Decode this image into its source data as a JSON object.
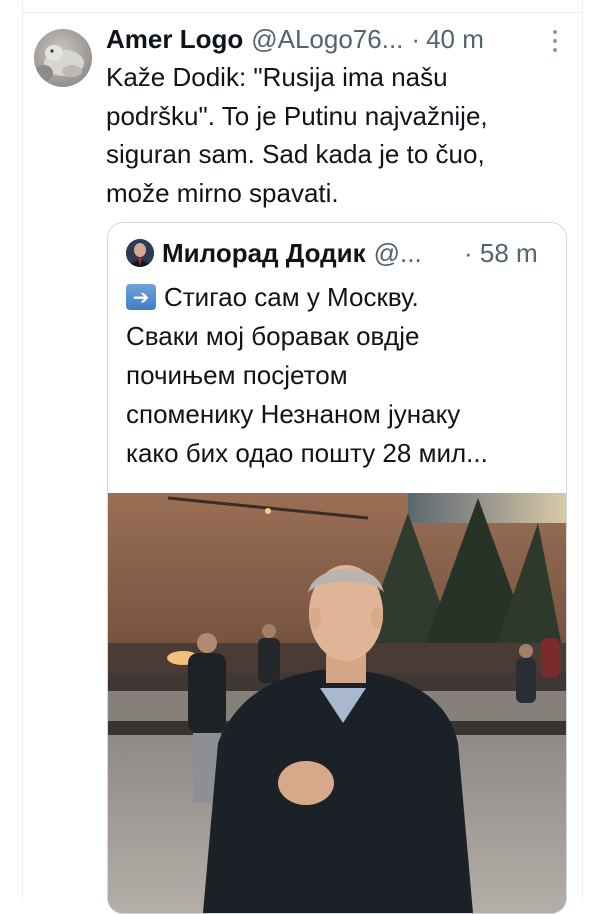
{
  "tweet": {
    "display_name": "Amer Logo",
    "handle": "@ALogo76...",
    "separator": "·",
    "time": "40 m",
    "text_lines": [
      "Kaže Dodik: \"Rusija ima našu",
      "podršku\". To je Putinu najvažnije,",
      "siguran sam. Sad kada je to čuo,",
      "može mirno spavati."
    ]
  },
  "quoted_tweet": {
    "display_name": "Милорад Додик",
    "handle": "@...",
    "separator": "·",
    "time": "58 m",
    "text_lines": [
      "Стигао сам у Москву.",
      "Сваки мој боравак овдје",
      "почињем посјетом",
      "споменику Незнаном јунаку",
      "како бих одао пошту 28 мил..."
    ],
    "leading_emoji": "right-arrow-emoji"
  },
  "icons": {
    "more": "more-vertical-icon",
    "avatar": "user-avatar",
    "quoted_avatar": "quoted-user-avatar"
  },
  "colors": {
    "text_primary": "#0f1419",
    "text_secondary": "#536471",
    "border": "#cfd9de"
  }
}
